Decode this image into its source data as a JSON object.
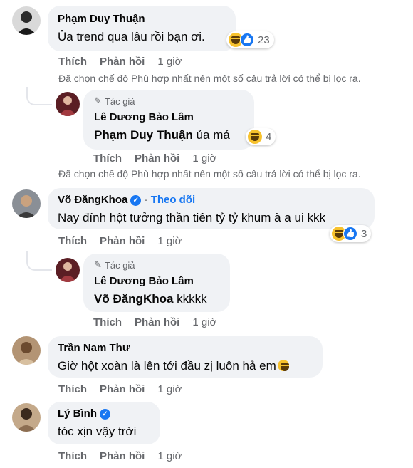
{
  "filter_notice": "Đã chọn chế độ Phù hợp nhất nên một số câu trả lời có thể bị lọc ra.",
  "labels": {
    "like": "Thích",
    "reply": "Phản hồi",
    "author_badge": "Tác giả",
    "follow": "Theo dõi"
  },
  "comments": [
    {
      "name": "Phạm Duy Thuận",
      "text": "Ủa trend qua lâu rồi bạn ơi.",
      "reaction_count": "23",
      "time": "1 giờ"
    },
    {
      "name": "Lê Dương Bảo Lâm",
      "mention": "Phạm Duy Thuận",
      "text": " ủa má",
      "reaction_count": "4",
      "time": "1 giờ"
    },
    {
      "name": "Võ ĐăngKhoa",
      "text": "Nay đính hột tưởng thần tiên tỷ tỷ khum à a ui kkk",
      "reaction_count": "3",
      "time": "1 giờ"
    },
    {
      "name": "Lê Dương Bảo Lâm",
      "mention": "Võ ĐăngKhoa",
      "text": " kkkkk",
      "time": "1 giờ"
    },
    {
      "name": "Trần Nam Thư",
      "text": "Giờ hột xoàn là lên tới đầu zị luôn hả em",
      "time": "1 giờ"
    },
    {
      "name": "Lý Bình",
      "text": "tóc xịn vậy trời",
      "time": "1 giờ"
    }
  ],
  "colors": {
    "bubble": "#f0f2f5",
    "link": "#1877f2",
    "secondary": "#65676b"
  }
}
